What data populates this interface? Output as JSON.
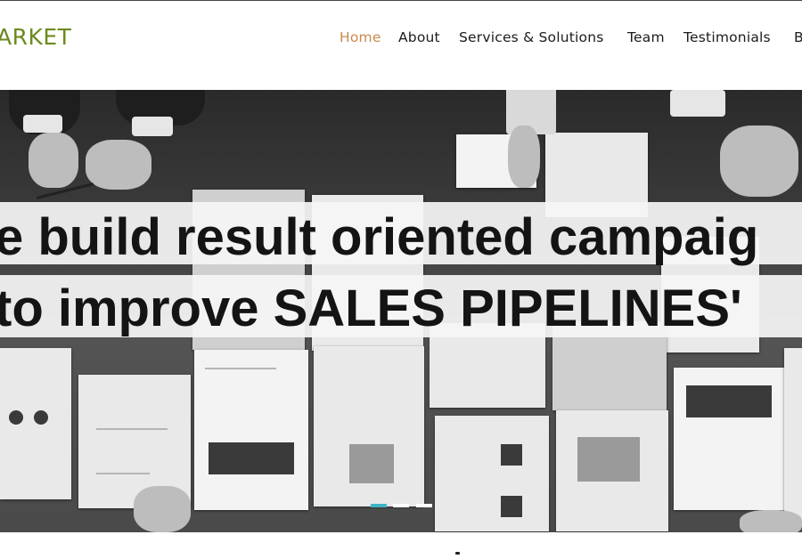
{
  "brand": {
    "logo_text": "ARKET",
    "logo_color": "#6c8a1e"
  },
  "nav": {
    "items": [
      {
        "label": "Home",
        "active": true
      },
      {
        "label": "About",
        "active": false
      },
      {
        "label": "Services & Solutions",
        "active": false
      },
      {
        "label": "Team",
        "active": false
      },
      {
        "label": "Testimonials",
        "active": false
      },
      {
        "label": "B",
        "active": false
      }
    ],
    "active_color": "#c98a4e"
  },
  "hero": {
    "headline_line1": "e build result oriented campaig",
    "headline_line2": "to improve SALES PIPELINES'",
    "slider": {
      "slide_count": 3,
      "active_index": 0,
      "active_color": "#3fb4c9"
    }
  }
}
